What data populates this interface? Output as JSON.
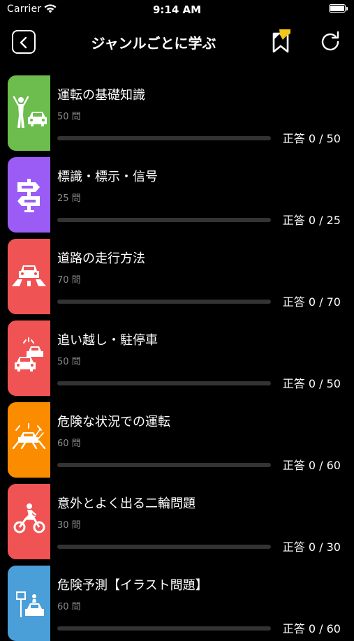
{
  "status_bar": {
    "carrier": "Carrier",
    "time": "9:14 AM"
  },
  "nav": {
    "title": "ジャンルごとに学ぶ"
  },
  "colors": {
    "green": "#6cbc4e",
    "purple": "#9b5cf6",
    "red": "#f05353",
    "orange": "#fb8c00",
    "blue": "#4a9fd9",
    "bookmark_accent": "#f5c518"
  },
  "genres": [
    {
      "title": "運転の基礎知識",
      "count": "50 問",
      "score": "正答 0 / 50",
      "correct": 0,
      "total": 50,
      "icon": "traffic-officer-car-icon"
    },
    {
      "title": "標識・標示・信号",
      "count": "25 問",
      "score": "正答 0 / 25",
      "correct": 0,
      "total": 25,
      "icon": "signpost-icon"
    },
    {
      "title": "道路の走行方法",
      "count": "70 問",
      "score": "正答 0 / 70",
      "correct": 0,
      "total": 70,
      "icon": "car-on-road-icon"
    },
    {
      "title": "追い越し・駐停車",
      "count": "50 問",
      "score": "正答 0 / 50",
      "correct": 0,
      "total": 50,
      "icon": "overtaking-cars-icon"
    },
    {
      "title": "危険な状況での運転",
      "count": "60 問",
      "score": "正答 0 / 60",
      "correct": 0,
      "total": 60,
      "icon": "dangerous-situation-icon"
    },
    {
      "title": "意外とよく出る二輪問題",
      "count": "30 問",
      "score": "正答 0 / 30",
      "correct": 0,
      "total": 30,
      "icon": "motorcycle-icon"
    },
    {
      "title": "危険予測【イラスト問題】",
      "count": "60 問",
      "score": "正答 0 / 60",
      "correct": 0,
      "total": 60,
      "icon": "hazard-prediction-icon"
    }
  ]
}
